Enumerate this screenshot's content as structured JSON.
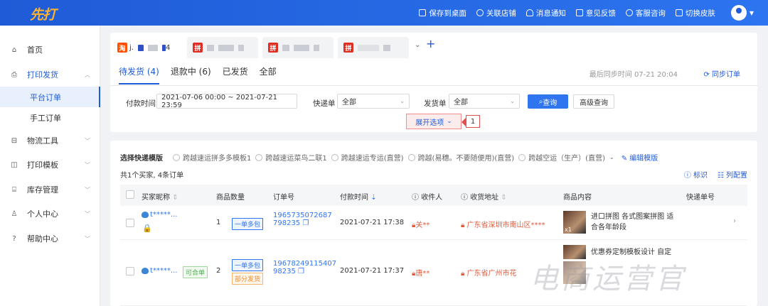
{
  "app": {
    "logo": "先打"
  },
  "topbar": {
    "links": [
      {
        "label": "保存到桌面",
        "icon": "desktop-icon"
      },
      {
        "label": "关联店铺",
        "icon": "link-icon"
      },
      {
        "label": "消息通知",
        "icon": "bell-icon"
      },
      {
        "label": "意见反馈",
        "icon": "feedback-icon"
      },
      {
        "label": "客服咨询",
        "icon": "headset-icon"
      },
      {
        "label": "切换皮肤",
        "icon": "shirt-icon"
      }
    ]
  },
  "sidebar": {
    "items": [
      {
        "label": "首页",
        "icon": "home-icon"
      },
      {
        "label": "打印发货",
        "icon": "printer-icon"
      },
      {
        "label": "物流工具",
        "icon": "truck-icon"
      },
      {
        "label": "打印模板",
        "icon": "template-icon"
      },
      {
        "label": "库存管理",
        "icon": "warehouse-icon"
      },
      {
        "label": "个人中心",
        "icon": "user-icon"
      },
      {
        "label": "帮助中心",
        "icon": "help-icon"
      }
    ],
    "subitems": [
      {
        "label": "平台订单"
      },
      {
        "label": "手工订单"
      }
    ]
  },
  "shops": [
    {
      "badge": "淘",
      "name": "j.",
      "suffix": "4",
      "color": "#ff5000"
    },
    {
      "badge": "拼",
      "name": "",
      "suffix": "",
      "color": "#e02e24"
    },
    {
      "badge": "拼",
      "name": "",
      "suffix": "",
      "color": "#e02e24"
    },
    {
      "badge": "拼",
      "name": "",
      "suffix": "",
      "color": "#e02e24"
    }
  ],
  "status_tabs": [
    {
      "label": "待发货 (4)"
    },
    {
      "label": "退款中 (6)"
    },
    {
      "label": "已发货"
    },
    {
      "label": "全部"
    }
  ],
  "sync": {
    "time": "最后同步时间 07-21 20:04",
    "button": "同步订单"
  },
  "filters": {
    "pay_time_label": "付款时间",
    "pay_time_value": "2021-07-06 00:00 ~ 2021-07-21 23:59",
    "express_label": "快递单",
    "express_value": "全部",
    "ship_label": "发货单",
    "ship_value": "全部",
    "query": "查询",
    "advanced": "高级查询",
    "expand": "展开选项",
    "callout": "1"
  },
  "templates": {
    "title": "选择快递模版",
    "options": [
      "跨越速运拼多多模板1",
      "跨越速运菜鸟二联1",
      "跨越速运专运(直营)",
      "跨越(易穗。不要随便用)(直营)",
      "跨越空运（生产）(直营)"
    ],
    "edit": "编辑模版"
  },
  "summary": {
    "count": "共1个买家,   4条订单",
    "mark": "标识",
    "columns": "列配置"
  },
  "table": {
    "headers": [
      "买家昵称",
      "商品数量",
      "订单号",
      "付款时间",
      "收件人",
      "收货地址",
      "商品内容",
      "快递单号"
    ],
    "rows": [
      {
        "buyer": "t*****...",
        "qty": "1",
        "tag1": "一单多包",
        "tag2": "",
        "merge": "",
        "order_line1": "1965735072687",
        "order_line2": "798235",
        "pay_time": "2021-07-21 17:38",
        "receiver": "关**",
        "address": "广东省深圳市南山区****",
        "product": "进口拼图 各式图案拼图 适合各年龄段",
        "thumb_qty": "x1"
      },
      {
        "buyer": "t*****...",
        "qty": "2",
        "tag1": "一单多包",
        "tag2": "部分发货",
        "merge": "可合单",
        "order_line1": "19678249115407",
        "order_line2": "98235",
        "pay_time": "2021-07-21 17:37",
        "receiver": "唐**",
        "address": "广东省广州市花",
        "product": "优惠券定制模板设计 自定",
        "thumb_qty": ""
      }
    ]
  },
  "watermark": "电商运营官"
}
